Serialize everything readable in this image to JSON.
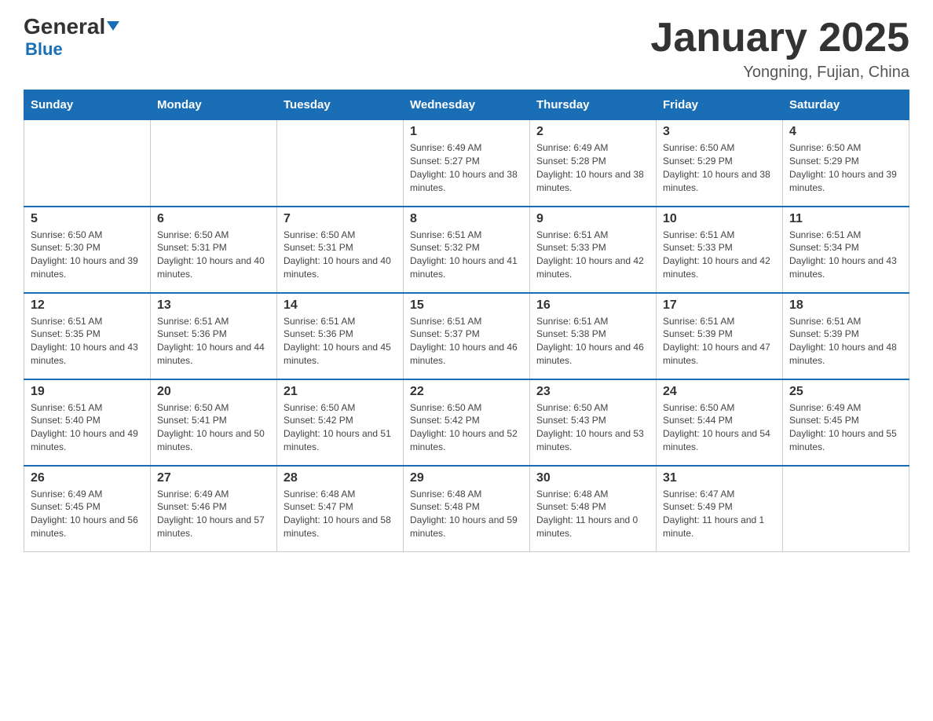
{
  "header": {
    "logo_general": "General",
    "logo_blue": "Blue",
    "month_title": "January 2025",
    "location": "Yongning, Fujian, China"
  },
  "days_of_week": [
    "Sunday",
    "Monday",
    "Tuesday",
    "Wednesday",
    "Thursday",
    "Friday",
    "Saturday"
  ],
  "weeks": [
    [
      {
        "day": "",
        "info": ""
      },
      {
        "day": "",
        "info": ""
      },
      {
        "day": "",
        "info": ""
      },
      {
        "day": "1",
        "info": "Sunrise: 6:49 AM\nSunset: 5:27 PM\nDaylight: 10 hours and 38 minutes."
      },
      {
        "day": "2",
        "info": "Sunrise: 6:49 AM\nSunset: 5:28 PM\nDaylight: 10 hours and 38 minutes."
      },
      {
        "day": "3",
        "info": "Sunrise: 6:50 AM\nSunset: 5:29 PM\nDaylight: 10 hours and 38 minutes."
      },
      {
        "day": "4",
        "info": "Sunrise: 6:50 AM\nSunset: 5:29 PM\nDaylight: 10 hours and 39 minutes."
      }
    ],
    [
      {
        "day": "5",
        "info": "Sunrise: 6:50 AM\nSunset: 5:30 PM\nDaylight: 10 hours and 39 minutes."
      },
      {
        "day": "6",
        "info": "Sunrise: 6:50 AM\nSunset: 5:31 PM\nDaylight: 10 hours and 40 minutes."
      },
      {
        "day": "7",
        "info": "Sunrise: 6:50 AM\nSunset: 5:31 PM\nDaylight: 10 hours and 40 minutes."
      },
      {
        "day": "8",
        "info": "Sunrise: 6:51 AM\nSunset: 5:32 PM\nDaylight: 10 hours and 41 minutes."
      },
      {
        "day": "9",
        "info": "Sunrise: 6:51 AM\nSunset: 5:33 PM\nDaylight: 10 hours and 42 minutes."
      },
      {
        "day": "10",
        "info": "Sunrise: 6:51 AM\nSunset: 5:33 PM\nDaylight: 10 hours and 42 minutes."
      },
      {
        "day": "11",
        "info": "Sunrise: 6:51 AM\nSunset: 5:34 PM\nDaylight: 10 hours and 43 minutes."
      }
    ],
    [
      {
        "day": "12",
        "info": "Sunrise: 6:51 AM\nSunset: 5:35 PM\nDaylight: 10 hours and 43 minutes."
      },
      {
        "day": "13",
        "info": "Sunrise: 6:51 AM\nSunset: 5:36 PM\nDaylight: 10 hours and 44 minutes."
      },
      {
        "day": "14",
        "info": "Sunrise: 6:51 AM\nSunset: 5:36 PM\nDaylight: 10 hours and 45 minutes."
      },
      {
        "day": "15",
        "info": "Sunrise: 6:51 AM\nSunset: 5:37 PM\nDaylight: 10 hours and 46 minutes."
      },
      {
        "day": "16",
        "info": "Sunrise: 6:51 AM\nSunset: 5:38 PM\nDaylight: 10 hours and 46 minutes."
      },
      {
        "day": "17",
        "info": "Sunrise: 6:51 AM\nSunset: 5:39 PM\nDaylight: 10 hours and 47 minutes."
      },
      {
        "day": "18",
        "info": "Sunrise: 6:51 AM\nSunset: 5:39 PM\nDaylight: 10 hours and 48 minutes."
      }
    ],
    [
      {
        "day": "19",
        "info": "Sunrise: 6:51 AM\nSunset: 5:40 PM\nDaylight: 10 hours and 49 minutes."
      },
      {
        "day": "20",
        "info": "Sunrise: 6:50 AM\nSunset: 5:41 PM\nDaylight: 10 hours and 50 minutes."
      },
      {
        "day": "21",
        "info": "Sunrise: 6:50 AM\nSunset: 5:42 PM\nDaylight: 10 hours and 51 minutes."
      },
      {
        "day": "22",
        "info": "Sunrise: 6:50 AM\nSunset: 5:42 PM\nDaylight: 10 hours and 52 minutes."
      },
      {
        "day": "23",
        "info": "Sunrise: 6:50 AM\nSunset: 5:43 PM\nDaylight: 10 hours and 53 minutes."
      },
      {
        "day": "24",
        "info": "Sunrise: 6:50 AM\nSunset: 5:44 PM\nDaylight: 10 hours and 54 minutes."
      },
      {
        "day": "25",
        "info": "Sunrise: 6:49 AM\nSunset: 5:45 PM\nDaylight: 10 hours and 55 minutes."
      }
    ],
    [
      {
        "day": "26",
        "info": "Sunrise: 6:49 AM\nSunset: 5:45 PM\nDaylight: 10 hours and 56 minutes."
      },
      {
        "day": "27",
        "info": "Sunrise: 6:49 AM\nSunset: 5:46 PM\nDaylight: 10 hours and 57 minutes."
      },
      {
        "day": "28",
        "info": "Sunrise: 6:48 AM\nSunset: 5:47 PM\nDaylight: 10 hours and 58 minutes."
      },
      {
        "day": "29",
        "info": "Sunrise: 6:48 AM\nSunset: 5:48 PM\nDaylight: 10 hours and 59 minutes."
      },
      {
        "day": "30",
        "info": "Sunrise: 6:48 AM\nSunset: 5:48 PM\nDaylight: 11 hours and 0 minutes."
      },
      {
        "day": "31",
        "info": "Sunrise: 6:47 AM\nSunset: 5:49 PM\nDaylight: 11 hours and 1 minute."
      },
      {
        "day": "",
        "info": ""
      }
    ]
  ]
}
